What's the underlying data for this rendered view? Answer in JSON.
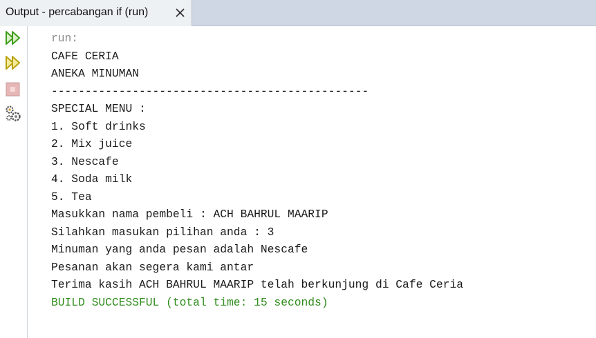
{
  "tab": {
    "title": "Output - percabangan if (run)",
    "close_icon": "close-icon"
  },
  "sidebar": {
    "buttons": [
      {
        "icon": "rerun-icon"
      },
      {
        "icon": "rerun-with-options-icon"
      },
      {
        "icon": "stop-icon"
      },
      {
        "icon": "settings-icon"
      }
    ]
  },
  "console": {
    "lines": [
      {
        "text": "run:",
        "style": "gray"
      },
      {
        "text": "CAFE CERIA",
        "style": "normal"
      },
      {
        "text": "ANEKA MINUMAN",
        "style": "normal"
      },
      {
        "text": "-----------------------------------------------",
        "style": "normal"
      },
      {
        "text": "SPECIAL MENU :",
        "style": "normal"
      },
      {
        "text": "1. Soft drinks",
        "style": "normal"
      },
      {
        "text": "2. Mix juice",
        "style": "normal"
      },
      {
        "text": "3. Nescafe",
        "style": "normal"
      },
      {
        "text": "4. Soda milk",
        "style": "normal"
      },
      {
        "text": "5. Tea",
        "style": "normal"
      },
      {
        "text": "Masukkan nama pembeli : ACH BAHRUL MAARIP",
        "style": "normal"
      },
      {
        "text": "Silahkan masukan pilihan anda : 3",
        "style": "normal"
      },
      {
        "text": "Minuman yang anda pesan adalah Nescafe",
        "style": "normal"
      },
      {
        "text": "Pesanan akan segera kami antar",
        "style": "normal"
      },
      {
        "text": "Terima kasih ACH BAHRUL MAARIP telah berkunjung di Cafe Ceria",
        "style": "normal"
      },
      {
        "text": "BUILD SUCCESSFUL (total time: 15 seconds)",
        "style": "green"
      }
    ]
  },
  "colors": {
    "tabbar_bg": "#ced7e3",
    "tab_bg": "#eef1f4",
    "run_icon": "#4aa51c",
    "success_text": "#2f8c1c",
    "muted_text": "#8a8a8a"
  }
}
